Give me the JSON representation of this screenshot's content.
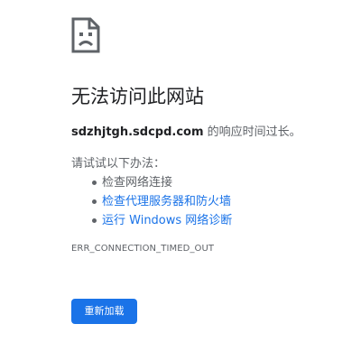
{
  "icon": "sad-document-icon",
  "title": "无法访问此网站",
  "message": {
    "host": "sdzhjtgh.sdcpd.com",
    "suffix": " 的响应时间过长。"
  },
  "try_heading": "请试试以下办法：",
  "suggestions": [
    {
      "label": "检查网络连接",
      "is_link": false
    },
    {
      "label": "检查代理服务器和防火墙",
      "is_link": true
    },
    {
      "label": "运行 Windows 网络诊断",
      "is_link": true
    }
  ],
  "error_code": "ERR_CONNECTION_TIMED_OUT",
  "reload_button": "重新加载",
  "colors": {
    "link": "#1a73e8",
    "button": "#1a73e8",
    "text": "#202124",
    "secondary_text": "#5f6368"
  }
}
